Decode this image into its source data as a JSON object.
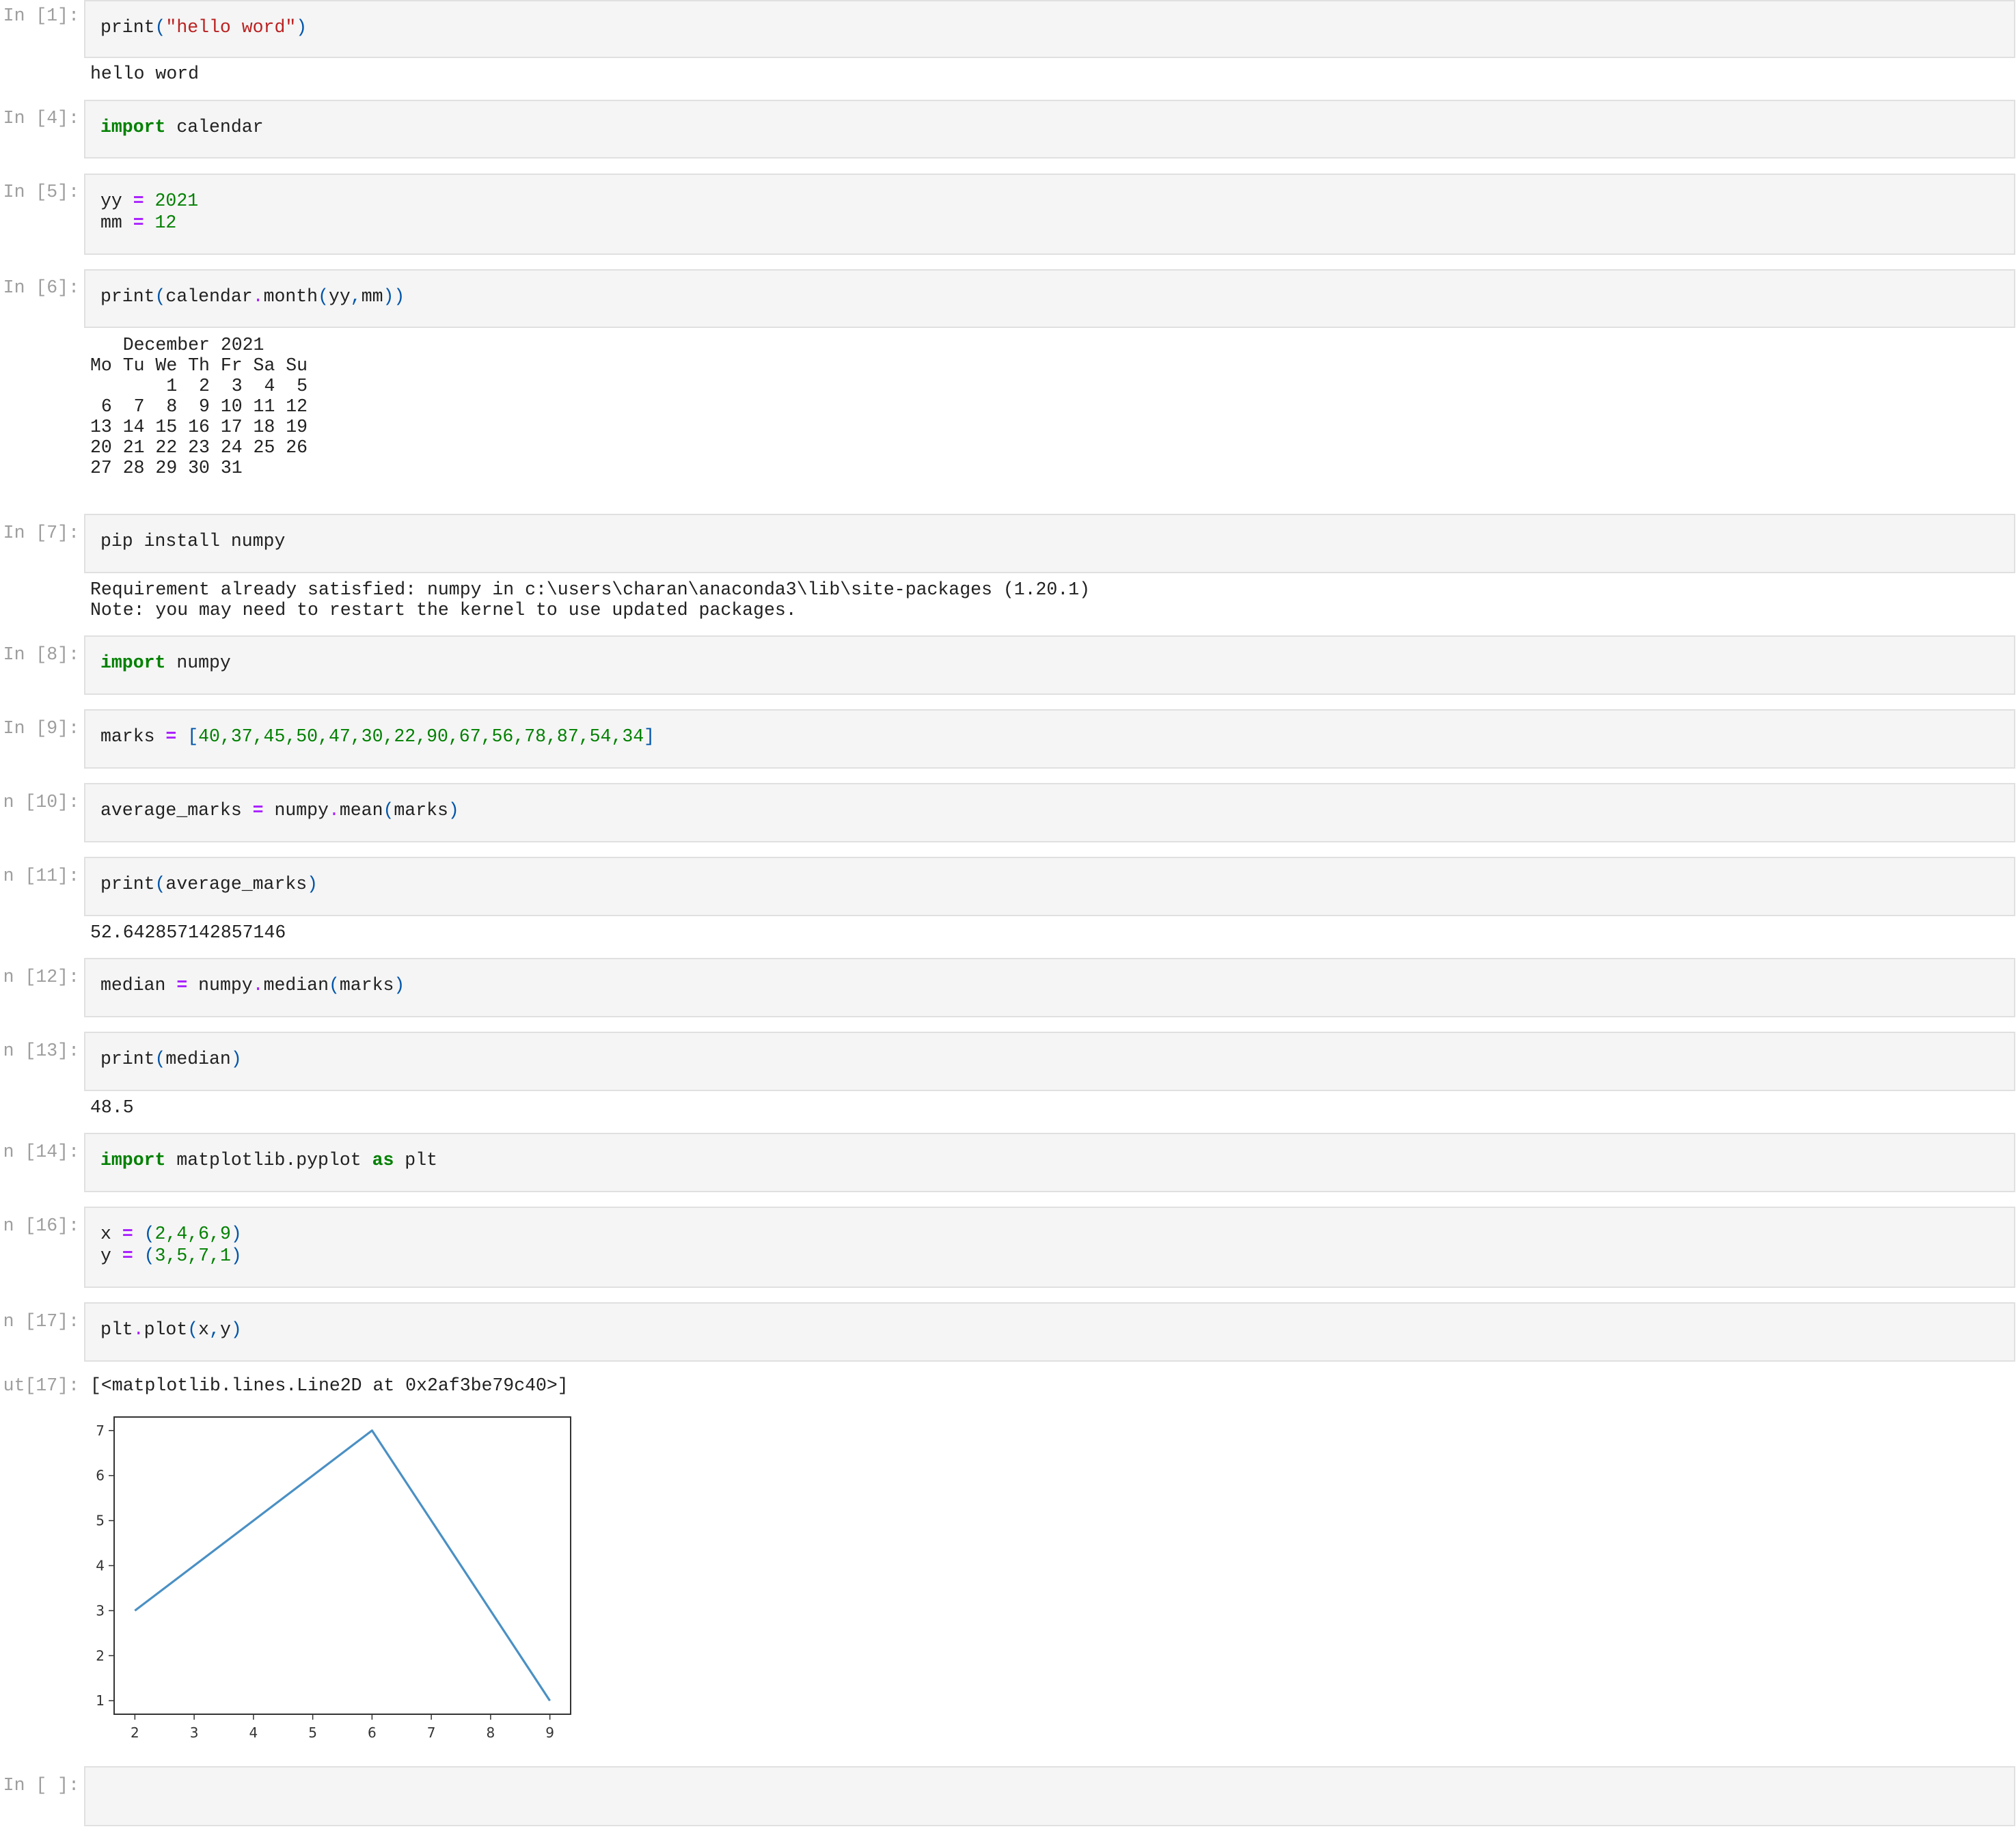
{
  "cells": [
    {
      "prompt": "In [1]:",
      "output": "hello word"
    },
    {
      "prompt": "In [4]:"
    },
    {
      "prompt": "In [5]:"
    },
    {
      "prompt": "In [6]:",
      "output": "   December 2021\nMo Tu We Th Fr Sa Su\n       1  2  3  4  5\n 6  7  8  9 10 11 12\n13 14 15 16 17 18 19\n20 21 22 23 24 25 26\n27 28 29 30 31"
    },
    {
      "prompt": "In [7]:",
      "output": "Requirement already satisfied: numpy in c:\\users\\charan\\anaconda3\\lib\\site-packages (1.20.1)\nNote: you may need to restart the kernel to use updated packages."
    },
    {
      "prompt": "In [8]:"
    },
    {
      "prompt": "In [9]:"
    },
    {
      "prompt": "n [10]:"
    },
    {
      "prompt": "n [11]:",
      "output": "52.642857142857146"
    },
    {
      "prompt": "n [12]:"
    },
    {
      "prompt": "n [13]:",
      "output": "48.5"
    },
    {
      "prompt": "n [14]:"
    },
    {
      "prompt": "n [16]:"
    },
    {
      "prompt": "n [17]:",
      "out_prompt": "ut[17]:",
      "output": "[<matplotlib.lines.Line2D at 0x2af3be79c40>]"
    },
    {
      "prompt": "In [ ]:"
    }
  ],
  "code": {
    "c1": {
      "fn": "print",
      "lp": "(",
      "str": "\"hello word\"",
      "rp": ")"
    },
    "c4": {
      "kw": "import",
      "mod": " calendar"
    },
    "c5": {
      "l1_var": "yy ",
      "l1_op": "=",
      "l1_num": " 2021",
      "l2_var": "mm ",
      "l2_op": "=",
      "l2_num": " 12"
    },
    "c6": {
      "fn": "print",
      "lp": "(",
      "obj": "calendar",
      "dot": ".",
      "meth": "month",
      "lp2": "(",
      "a1": "yy",
      "comma": ",",
      "a2": "mm",
      "rp": "))"
    },
    "c7": {
      "text": "pip install numpy"
    },
    "c8": {
      "kw": "import",
      "mod": " numpy"
    },
    "c9": {
      "var": "marks ",
      "op": "=",
      "sp": " ",
      "lb": "[",
      "nums": "40,37,45,50,47,30,22,90,67,56,78,87,54,34",
      "rb": "]"
    },
    "c10": {
      "var": "average_marks ",
      "op": "=",
      "obj": " numpy",
      "dot": ".",
      "meth": "mean",
      "lp": "(",
      "arg": "marks",
      "rp": ")"
    },
    "c11": {
      "fn": "print",
      "lp": "(",
      "arg": "average_marks",
      "rp": ")"
    },
    "c12": {
      "var": "median ",
      "op": "=",
      "obj": " numpy",
      "dot": ".",
      "meth": "median",
      "lp": "(",
      "arg": "marks",
      "rp": ")"
    },
    "c13": {
      "fn": "print",
      "lp": "(",
      "arg": "median",
      "rp": ")"
    },
    "c14": {
      "kw": "import",
      "mod": " matplotlib.pyplot ",
      "kw2": "as",
      "alias": " plt"
    },
    "c16": {
      "l1_var": "x ",
      "l1_op": "=",
      "l1_sp": " ",
      "l1_lp": "(",
      "l1_nums": "2,4,6,9",
      "l1_rp": ")",
      "l2_var": "y ",
      "l2_op": "=",
      "l2_sp": " ",
      "l2_lp": "(",
      "l2_nums": "3,5,7,1",
      "l2_rp": ")"
    },
    "c17": {
      "obj": "plt",
      "dot": ".",
      "meth": "plot",
      "lp": "(",
      "a1": "x",
      "comma": ",",
      "a2": "y",
      "rp": ")"
    }
  },
  "chart_data": {
    "type": "line",
    "x": [
      2,
      4,
      6,
      9
    ],
    "series": [
      {
        "values": [
          3,
          5,
          7,
          1
        ]
      }
    ],
    "xlim": [
      1.65,
      9.35
    ],
    "ylim": [
      0.7,
      7.3
    ],
    "xticks": [
      "2",
      "3",
      "4",
      "5",
      "6",
      "7",
      "8",
      "9"
    ],
    "yticks": [
      "1",
      "2",
      "3",
      "4",
      "5",
      "6",
      "7"
    ],
    "line_color": "#4a90c4",
    "grid": false
  }
}
